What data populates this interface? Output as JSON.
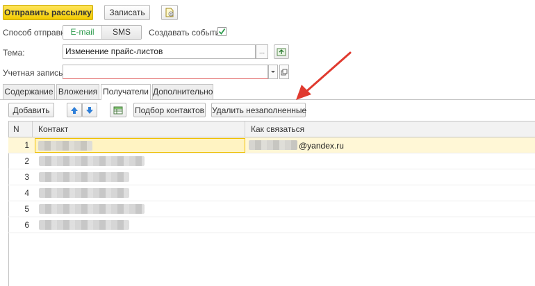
{
  "toolbar": {
    "send_label": "Отправить рассылку",
    "save_label": "Записать"
  },
  "send_method": {
    "label": "Способ отправки:",
    "options": [
      "E-mail",
      "SMS"
    ],
    "selected": "E-mail",
    "create_events_label": "Создавать события:",
    "create_events_checked": true
  },
  "subject": {
    "label": "Тема:",
    "value": "Изменение прайс-листов",
    "choose_btn": "..."
  },
  "account": {
    "label": "Учетная запись:",
    "value": ""
  },
  "tabs": [
    {
      "label": "Содержание"
    },
    {
      "label": "Вложения"
    },
    {
      "label": "Получатели"
    },
    {
      "label": "Дополнительно"
    }
  ],
  "active_tab": "Получатели",
  "recipients_toolbar": {
    "add_label": "Добавить",
    "pick_contacts_label": "Подбор контактов",
    "remove_empty_label": "Удалить незаполненные"
  },
  "table": {
    "columns": [
      "N",
      "Контакт",
      "Как связаться"
    ],
    "rows": [
      {
        "n": "1",
        "how_to_contact": "@yandex.ru"
      },
      {
        "n": "2",
        "how_to_contact": ""
      },
      {
        "n": "3",
        "how_to_contact": ""
      },
      {
        "n": "4",
        "how_to_contact": ""
      },
      {
        "n": "5",
        "how_to_contact": ""
      },
      {
        "n": "6",
        "how_to_contact": ""
      }
    ]
  },
  "colors": {
    "primary_button": "#f2cb00",
    "selected_row": "#fff7d6",
    "arrow": "#e03a2f",
    "required_underline": "#e06060"
  }
}
